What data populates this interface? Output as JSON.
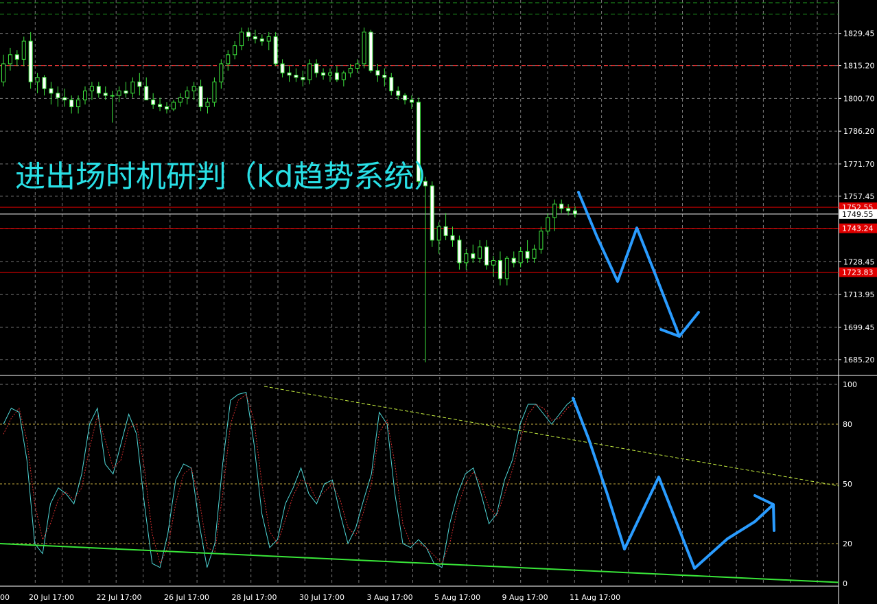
{
  "chart_data": [
    {
      "type": "candlestick",
      "title": "进出场时机研判（kd趋势系统）",
      "ylim": [
        1680.0,
        1843.0
      ],
      "y_ticks": [
        "1829.45",
        "1815.20",
        "1800.70",
        "1786.20",
        "1771.70",
        "1757.45",
        "1743.24",
        "1728.45",
        "1713.95",
        "1699.45",
        "1685.20"
      ],
      "x_ticks": [
        "00",
        "20 Jul 17:00",
        "22 Jul 17:00",
        "26 Jul 17:00",
        "28 Jul 17:00",
        "30 Jul 17:00",
        "3 Aug 17:00",
        "5 Aug 17:00",
        "9 Aug 17:00",
        "11 Aug 17:00"
      ],
      "horizontal_levels": [
        {
          "price": 1752.55,
          "label": "1752.55",
          "color": "#ff0000"
        },
        {
          "price": 1749.55,
          "label": "1749.55",
          "color": "#ffffff"
        },
        {
          "price": 1743.24,
          "label": "1743.24",
          "color": "#ff0000"
        },
        {
          "price": 1723.83,
          "label": "1723.83",
          "color": "#ff0000"
        }
      ],
      "dashed_levels": [
        {
          "price": 1815.2,
          "color": "#ff3333"
        },
        {
          "price": 1843.0,
          "color": "#1f9e1f"
        },
        {
          "price": 1838.0,
          "color": "#1f9e1f"
        }
      ],
      "candles": [
        [
          1808.0,
          1820.0,
          1806.0,
          1816.0
        ],
        [
          1816.0,
          1823.0,
          1813.0,
          1820.0
        ],
        [
          1820.0,
          1822.0,
          1815.0,
          1818.0
        ],
        [
          1818.0,
          1828.0,
          1815.0,
          1826.0
        ],
        [
          1826.0,
          1830.0,
          1805.0,
          1808.0
        ],
        [
          1808.0,
          1812.0,
          1803.0,
          1810.0
        ],
        [
          1810.0,
          1811.0,
          1802.0,
          1805.0
        ],
        [
          1805.0,
          1808.0,
          1798.0,
          1803.0
        ],
        [
          1803.0,
          1806.0,
          1797.0,
          1801.0
        ],
        [
          1801.0,
          1805.0,
          1797.0,
          1800.0
        ],
        [
          1800.0,
          1802.0,
          1794.0,
          1797.0
        ],
        [
          1797.0,
          1802.0,
          1794.0,
          1800.0
        ],
        [
          1800.0,
          1806.0,
          1798.0,
          1804.0
        ],
        [
          1804.0,
          1808.0,
          1800.0,
          1806.0
        ],
        [
          1806.0,
          1808.0,
          1801.0,
          1803.0
        ],
        [
          1803.0,
          1806.0,
          1800.0,
          1802.0
        ],
        [
          1802.0,
          1804.0,
          1790.0,
          1802.0
        ],
        [
          1802.0,
          1806.0,
          1799.0,
          1804.0
        ],
        [
          1804.0,
          1808.0,
          1801.0,
          1803.0
        ],
        [
          1803.0,
          1810.0,
          1801.0,
          1808.0
        ],
        [
          1808.0,
          1812.0,
          1802.0,
          1806.0
        ],
        [
          1806.0,
          1810.0,
          1800.0,
          1800.0
        ],
        [
          1800.0,
          1803.0,
          1796.0,
          1798.0
        ],
        [
          1798.0,
          1801.0,
          1795.0,
          1797.0
        ],
        [
          1797.0,
          1799.0,
          1794.0,
          1796.0
        ],
        [
          1796.0,
          1800.0,
          1795.0,
          1799.0
        ],
        [
          1799.0,
          1803.0,
          1797.0,
          1801.0
        ],
        [
          1801.0,
          1806.0,
          1798.0,
          1804.0
        ],
        [
          1804.0,
          1808.0,
          1800.0,
          1806.0
        ],
        [
          1806.0,
          1809.0,
          1795.0,
          1797.0
        ],
        [
          1797.0,
          1801.0,
          1794.0,
          1799.0
        ],
        [
          1799.0,
          1810.0,
          1797.0,
          1808.0
        ],
        [
          1808.0,
          1818.0,
          1805.0,
          1816.0
        ],
        [
          1816.0,
          1822.0,
          1813.0,
          1820.0
        ],
        [
          1820.0,
          1826.0,
          1818.0,
          1824.0
        ],
        [
          1824.0,
          1832.0,
          1822.0,
          1830.0
        ],
        [
          1830.0,
          1832.0,
          1826.0,
          1828.0
        ],
        [
          1828.0,
          1831.0,
          1825.0,
          1827.0
        ],
        [
          1827.0,
          1829.0,
          1824.0,
          1826.0
        ],
        [
          1826.0,
          1830.0,
          1822.0,
          1828.0
        ],
        [
          1828.0,
          1830.0,
          1815.0,
          1816.0
        ],
        [
          1816.0,
          1818.0,
          1810.0,
          1812.0
        ],
        [
          1812.0,
          1815.0,
          1808.0,
          1811.0
        ],
        [
          1811.0,
          1814.0,
          1808.0,
          1810.0
        ],
        [
          1810.0,
          1813.0,
          1806.0,
          1809.0
        ],
        [
          1809.0,
          1818.0,
          1807.0,
          1816.0
        ],
        [
          1816.0,
          1818.0,
          1810.0,
          1812.0
        ],
        [
          1812.0,
          1814.0,
          1809.0,
          1811.0
        ],
        [
          1811.0,
          1814.0,
          1808.0,
          1812.0
        ],
        [
          1812.0,
          1815.0,
          1808.0,
          1809.0
        ],
        [
          1809.0,
          1813.0,
          1806.0,
          1812.0
        ],
        [
          1812.0,
          1816.0,
          1810.0,
          1814.0
        ],
        [
          1814.0,
          1818.0,
          1812.0,
          1816.0
        ],
        [
          1816.0,
          1832.0,
          1814.0,
          1830.0
        ],
        [
          1830.0,
          1831.0,
          1812.0,
          1813.0
        ],
        [
          1813.0,
          1816.0,
          1808.0,
          1811.0
        ],
        [
          1811.0,
          1814.0,
          1806.0,
          1810.0
        ],
        [
          1810.0,
          1812.0,
          1802.0,
          1804.0
        ],
        [
          1804.0,
          1806.0,
          1800.0,
          1802.0
        ],
        [
          1802.0,
          1803.0,
          1798.0,
          1800.0
        ],
        [
          1800.0,
          1802.0,
          1796.0,
          1799.0
        ],
        [
          1799.0,
          1801.0,
          1762.0,
          1764.0
        ],
        [
          1764.0,
          1766.0,
          1684.0,
          1762.0
        ],
        [
          1762.0,
          1764.0,
          1735.0,
          1738.0
        ],
        [
          1738.0,
          1746.0,
          1732.0,
          1744.0
        ],
        [
          1744.0,
          1750.0,
          1738.0,
          1740.0
        ],
        [
          1740.0,
          1744.0,
          1735.0,
          1738.0
        ],
        [
          1738.0,
          1740.0,
          1725.0,
          1728.0
        ],
        [
          1728.0,
          1734.0,
          1725.0,
          1732.0
        ],
        [
          1732.0,
          1736.0,
          1728.0,
          1730.0
        ],
        [
          1730.0,
          1738.0,
          1728.0,
          1735.0
        ],
        [
          1735.0,
          1738.0,
          1725.0,
          1727.0
        ],
        [
          1727.0,
          1731.0,
          1722.0,
          1729.0
        ],
        [
          1729.0,
          1733.0,
          1718.0,
          1721.0
        ],
        [
          1721.0,
          1731.0,
          1718.0,
          1730.0
        ],
        [
          1730.0,
          1733.0,
          1726.0,
          1728.0
        ],
        [
          1728.0,
          1735.0,
          1726.0,
          1733.0
        ],
        [
          1733.0,
          1738.0,
          1728.0,
          1730.0
        ],
        [
          1730.0,
          1736.0,
          1728.0,
          1734.0
        ],
        [
          1734.0,
          1744.0,
          1732.0,
          1742.0
        ],
        [
          1742.0,
          1750.0,
          1740.0,
          1748.0
        ],
        [
          1748.0,
          1756.0,
          1742.0,
          1754.0
        ],
        [
          1754.0,
          1756.0,
          1750.0,
          1752.0
        ],
        [
          1752.0,
          1754.0,
          1749.0,
          1751.0
        ],
        [
          1751.0,
          1753.0,
          1748.0,
          1749.5
        ]
      ]
    },
    {
      "type": "line",
      "ylim": [
        0,
        100
      ],
      "y_ticks": [
        "100",
        "80",
        "50",
        "20",
        "0"
      ],
      "dashed_levels": [
        80,
        50,
        20
      ],
      "series": [
        {
          "color": "#4fd7d7",
          "values": [
            80,
            88,
            86,
            62,
            20,
            15,
            40,
            48,
            45,
            40,
            55,
            80,
            88,
            60,
            55,
            70,
            85,
            75,
            40,
            10,
            8,
            25,
            52,
            60,
            58,
            30,
            8,
            20,
            60,
            92,
            95,
            96,
            70,
            35,
            18,
            22,
            40,
            48,
            58,
            45,
            40,
            50,
            52,
            35,
            20,
            28,
            42,
            55,
            86,
            80,
            45,
            20,
            18,
            22,
            18,
            10,
            8,
            30,
            45,
            55,
            58,
            45,
            30,
            35,
            52,
            62,
            80,
            90,
            90,
            85,
            80,
            85,
            90,
            93
          ]
        },
        {
          "color": "#d22d2d",
          "values": [
            75,
            83,
            88,
            72,
            40,
            22,
            30,
            42,
            46,
            42,
            48,
            68,
            84,
            72,
            58,
            62,
            78,
            80,
            58,
            25,
            10,
            18,
            40,
            55,
            58,
            42,
            18,
            16,
            45,
            80,
            92,
            95,
            82,
            50,
            26,
            20,
            32,
            44,
            52,
            50,
            42,
            46,
            50,
            42,
            28,
            24,
            36,
            50,
            76,
            82,
            60,
            30,
            20,
            20,
            18,
            14,
            10,
            20,
            38,
            50,
            56,
            50,
            38,
            34,
            45,
            57,
            72,
            85,
            90,
            88,
            82,
            83,
            88,
            91
          ]
        }
      ]
    }
  ],
  "annotations": {
    "price_forecast_path": "blue-down-zigzag",
    "indicator_forecast_path": "blue-down-up-zigzag"
  }
}
